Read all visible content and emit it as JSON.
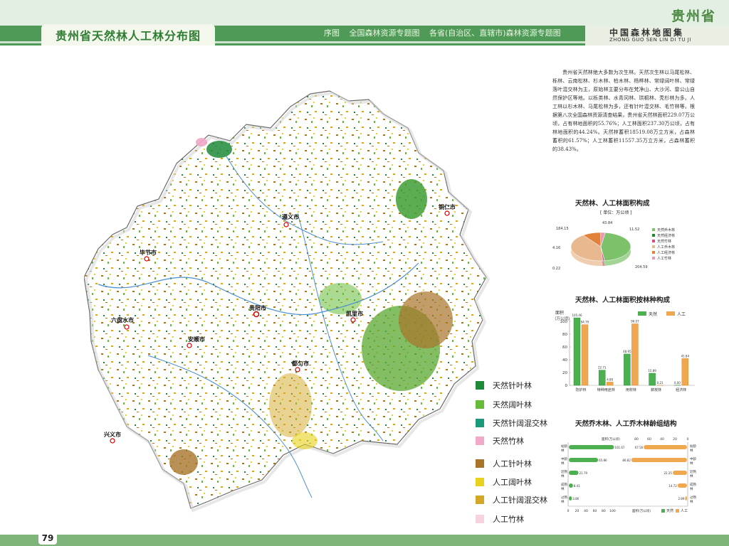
{
  "header": {
    "page_title": "贵州省天然林人工林分布图",
    "nav_items": [
      "序图",
      "全国森林资源专题图",
      "各省(自治区、直辖市)森林资源专题图"
    ],
    "province_label": "贵州省",
    "atlas_title": "中国森林地图集",
    "atlas_pinyin": "ZHONG GUO SEN LIN DI TU JI"
  },
  "page_number": "79",
  "description": "贵州省天然林绝大多数为次生林。天然次生林以马尾松林、栎林、云南松林、杉木林、柏木林、杨桦林、常绿阔叶林、常绿落叶混交林为主，原始林主要分布在梵净山、大沙河、雷公山自然保护区等地。以栎类林、水青冈林、珙桐林、秃杉林为多。人工林以杉木林、马尾松林为多，还有针叶混交林、毛竹林等。根据第八次全国森林资源清查结果，贵州省天然林面积229.07万公顷，占有林地面积的55.76%；人工林面积237.30万公顷，占有林地面积的44.24%。天然林蓄积18519.08万立方米，占森林蓄积的61.57%；人工林蓄积11557.35万立方米，占森林蓄积的38.43%。",
  "map_legend": [
    {
      "label": "天然针叶林",
      "color": "#1f8a3a"
    },
    {
      "label": "天然阔叶林",
      "color": "#66bb38"
    },
    {
      "label": "天然针阔混交林",
      "color": "#1a9a7a"
    },
    {
      "label": "天然竹林",
      "color": "#f0a9c9"
    },
    {
      "label": "人工针叶林",
      "color": "#a8742a"
    },
    {
      "label": "人工阔叶林",
      "color": "#e8d21c"
    },
    {
      "label": "人工针阔混交林",
      "color": "#d4a726"
    },
    {
      "label": "人工竹林",
      "color": "#f7d3de"
    }
  ],
  "map_labels": [
    "遵义市",
    "贵阳市",
    "安顺市",
    "六盘水市",
    "毕节市",
    "铜仁市",
    "兴义市",
    "都匀市",
    "凯里市"
  ],
  "colors": {
    "header_green": "#4f9a56",
    "natural": "#5cb85c",
    "planted": "#f0a850"
  },
  "chart_data": [
    {
      "type": "pie",
      "title": "天然林、人工林面积构成",
      "subtitle": "[ 单位：万公顷 ]",
      "slices": [
        {
          "name": "天然乔木林",
          "value": 204.59,
          "color": "#7cc26a"
        },
        {
          "name": "天然经济林",
          "value": 0.22,
          "color": "#1a8a2a"
        },
        {
          "name": "天然竹林",
          "value": 4.16,
          "color": "#d44a8a"
        },
        {
          "name": "人工乔木林",
          "value": 184.15,
          "color": "#e8b98e"
        },
        {
          "name": "人工经济林",
          "value": 43.84,
          "color": "#e0823a"
        },
        {
          "name": "人工竹林",
          "value": 11.52,
          "color": "#e89ab0"
        }
      ],
      "value_labels": [
        "184.15",
        "43.84",
        "11.52",
        "4.16",
        "0.22",
        "204.59"
      ]
    },
    {
      "type": "bar",
      "title": "天然林、人工林面积按林种构成",
      "ylabel": "面积（万公顷）",
      "categories": [
        "防护林",
        "特种用途林",
        "用材林",
        "薪炭林",
        "经济林"
      ],
      "series": [
        {
          "name": "天然",
          "values": [
            105.46,
            23.71,
            48.95,
            18.89,
            0.22
          ],
          "labels": [
            "105.46",
            "22.71",
            "48.95",
            "15.89",
            "0.00"
          ],
          "color": "#4caf50"
        },
        {
          "name": "人工",
          "values": [
            94.79,
            5.05,
            96.07,
            0.21,
            41.84
          ],
          "labels": [
            "94.79",
            "4.80",
            "96.07",
            "0.21",
            "41.84"
          ],
          "color": "#f0a850"
        }
      ],
      "ylim": [
        0,
        100
      ],
      "yticks": [
        0,
        20,
        40,
        60,
        80,
        100
      ]
    },
    {
      "type": "bar",
      "orientation": "horizontal-butterfly",
      "title": "天然乔木林、人工乔木林龄组结构",
      "axis_label": "面积(万公顷)",
      "categories": [
        "幼龄林",
        "中龄林",
        "近熟林",
        "成熟林",
        "过熟林"
      ],
      "series": [
        {
          "name": "天然",
          "values": [
            101.67,
            65.86,
            21.79,
            9.41,
            6.86
          ],
          "labels": [
            "101.67",
            "65.86",
            "21.79",
            "8.41",
            "3.86"
          ],
          "color": "#4caf50"
        },
        {
          "name": "人工",
          "values": [
            67.56,
            86.82,
            22.25,
            14.72,
            2.89
          ],
          "labels": [
            "67.56",
            "86.82",
            "22.25",
            "14.72",
            "2.89"
          ],
          "color": "#f0a850"
        }
      ],
      "xticks_left": [
        0,
        20,
        40,
        60,
        80,
        100
      ],
      "xticks_right_top": [
        80,
        60,
        40,
        20,
        0
      ],
      "xticks_bottom": [
        0,
        20,
        40,
        60,
        80,
        100
      ]
    }
  ]
}
